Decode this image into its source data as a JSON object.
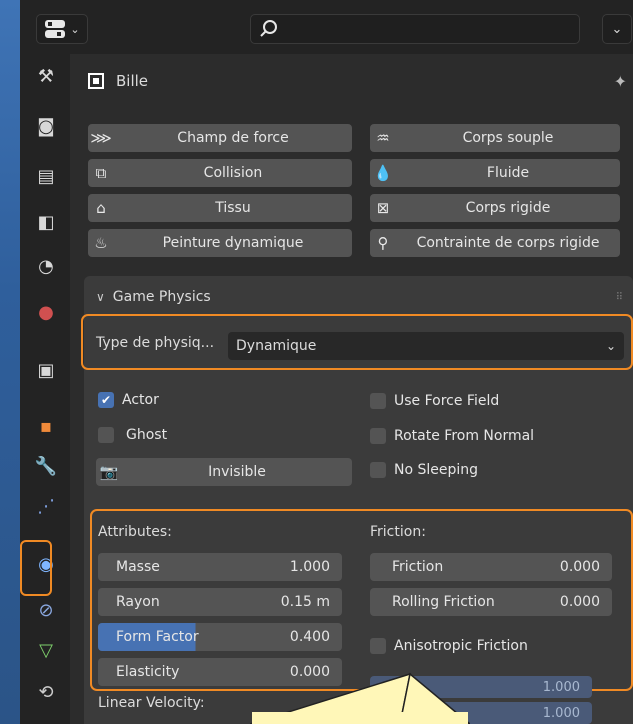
{
  "header": {
    "editor_type_icon": "properties-editor-icon",
    "search_icon": "search-icon",
    "dropdown_icon": "chevron-down-icon"
  },
  "sidebar": {
    "tabs": [
      {
        "name": "tool-settings-icon",
        "glyph": "⚒"
      },
      {
        "name": "render-icon",
        "glyph": "◙"
      },
      {
        "name": "output-icon",
        "glyph": "▤"
      },
      {
        "name": "view-layer-icon",
        "glyph": "◧"
      },
      {
        "name": "scene-icon",
        "glyph": "◔"
      },
      {
        "name": "world-icon",
        "glyph": "●"
      },
      {
        "name": "collection-icon",
        "glyph": "▣"
      },
      {
        "name": "object-icon",
        "glyph": "▪"
      },
      {
        "name": "modifier-icon",
        "glyph": "🔧"
      },
      {
        "name": "particles-icon",
        "glyph": "⋰"
      },
      {
        "name": "physics-icon",
        "glyph": "◉"
      },
      {
        "name": "constraints-icon",
        "glyph": "⊘"
      },
      {
        "name": "object-data-icon",
        "glyph": "▽"
      },
      {
        "name": "texture-icon",
        "glyph": "⟲"
      }
    ]
  },
  "object": {
    "name": "Bille",
    "pin_icon": "pin-icon"
  },
  "physics_buttons": [
    {
      "label": "Champ de force",
      "icon": "force-field-icon",
      "glyph": "⋙"
    },
    {
      "label": "Corps souple",
      "icon": "soft-body-icon",
      "glyph": "♒"
    },
    {
      "label": "Collision",
      "icon": "collision-icon",
      "glyph": "⧉"
    },
    {
      "label": "Fluide",
      "icon": "fluid-icon",
      "glyph": "💧"
    },
    {
      "label": "Tissu",
      "icon": "cloth-icon",
      "glyph": "⌂"
    },
    {
      "label": "Corps rigide",
      "icon": "rigid-body-icon",
      "glyph": "⊠"
    },
    {
      "label": "Peinture dynamique",
      "icon": "dynamic-paint-icon",
      "glyph": "♨"
    },
    {
      "label": "Contrainte de corps rigide",
      "icon": "rigid-body-constraint-icon",
      "glyph": "⚲"
    }
  ],
  "game_physics": {
    "title": "Game Physics",
    "type_label": "Type de physiq...",
    "type_value": "Dynamique",
    "actor": "Actor",
    "ghost": "Ghost",
    "invisible": "Invisible",
    "use_force_field": "Use Force Field",
    "rotate_from_normal": "Rotate From Normal",
    "no_sleeping": "No Sleeping",
    "actor_checked": true,
    "attributes_label": "Attributes:",
    "friction_label": "Friction:",
    "attributes": [
      {
        "label": "Masse",
        "value": "1.000"
      },
      {
        "label": "Rayon",
        "value": "0.15 m"
      },
      {
        "label": "Form Factor",
        "value": "0.400",
        "fill_fraction": 0.4
      },
      {
        "label": "Elasticity",
        "value": "0.000"
      }
    ],
    "friction": [
      {
        "label": "Friction",
        "value": "0.000"
      },
      {
        "label": "Rolling Friction",
        "value": "0.000"
      }
    ],
    "anisotropic": "Anisotropic Friction",
    "aniso_values": [
      "1.000",
      "1.000"
    ],
    "linear_velocity": "Linear Velocity:"
  },
  "colors": {
    "accent": "#4772b3",
    "highlight": "#f08a24",
    "tooltip": "#fff5b0"
  }
}
